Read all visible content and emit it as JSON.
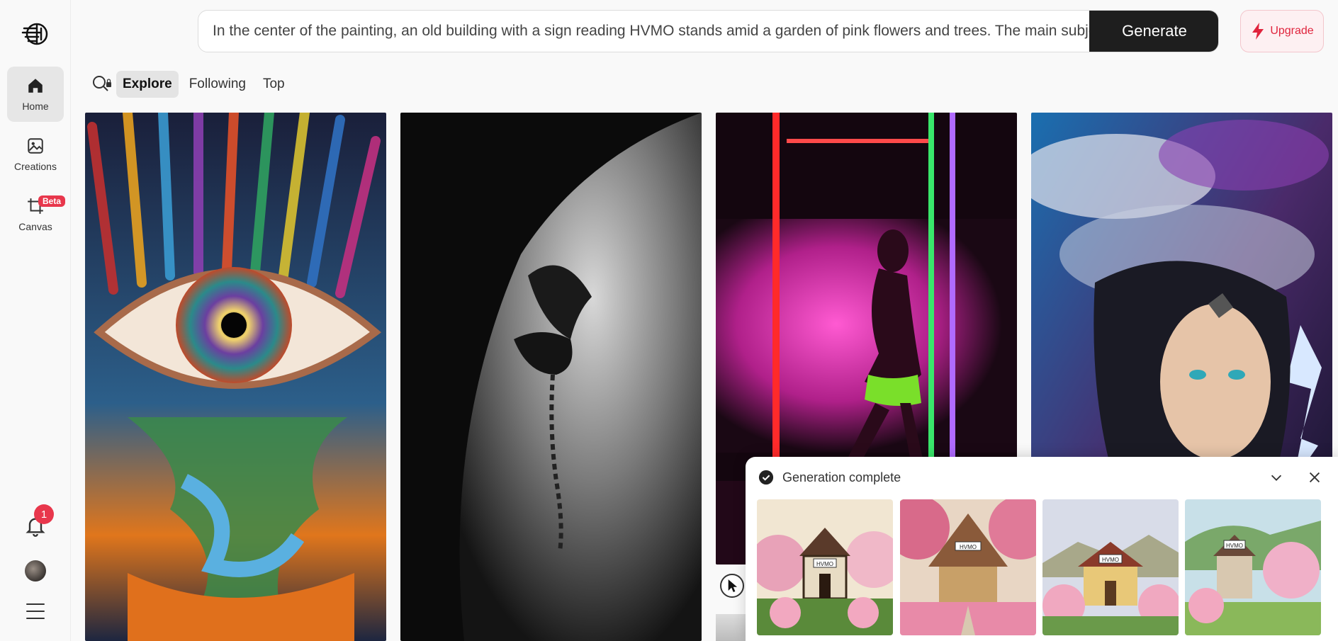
{
  "sidebar": {
    "logo_icon": "brain-logo-icon",
    "items": [
      {
        "label": "Home",
        "icon": "home-icon",
        "active": true
      },
      {
        "label": "Creations",
        "icon": "image-icon",
        "active": false
      },
      {
        "label": "Canvas",
        "icon": "crop-canvas-icon",
        "active": false,
        "badge": "Beta"
      }
    ],
    "notifications_count": "1"
  },
  "prompt": {
    "value": "In the center of the painting, an old building with a sign reading HVMO stands amid a garden of pink flowers and trees. The main subjec",
    "generate_label": "Generate"
  },
  "upgrade_label": "Upgrade",
  "tabs": [
    {
      "label": "Explore",
      "active": true
    },
    {
      "label": "Following",
      "active": false
    },
    {
      "label": "Top",
      "active": false
    }
  ],
  "gallery": [
    {
      "subject": "psychedelic-eye-feathers"
    },
    {
      "subject": "bw-dove-shoulder-tattoo"
    },
    {
      "subject": "neon-woman-pink-smoke"
    },
    {
      "subject": "storm-woman-lightning"
    }
  ],
  "generation": {
    "title": "Generation complete",
    "sign_text": "HVMO",
    "thumbnails": 4
  },
  "colors": {
    "accent": "#e8374c",
    "generate_bg": "#1e1e1e"
  }
}
